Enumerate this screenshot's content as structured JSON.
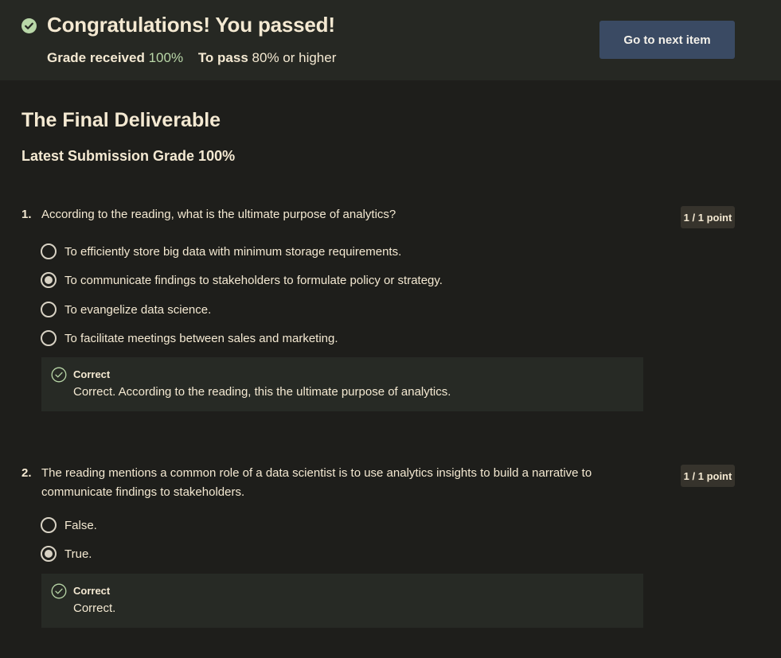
{
  "banner": {
    "title": "Congratulations! You passed!",
    "grade_label": "Grade received",
    "grade_value": "100%",
    "pass_label": "To pass",
    "pass_value": "80% or higher",
    "next_button": "Go to next item"
  },
  "page": {
    "title": "The Final Deliverable",
    "latest_grade": "Latest Submission Grade 100%"
  },
  "questions": [
    {
      "number": "1.",
      "text": "According to the reading, what is the ultimate purpose of analytics?",
      "points": "1 / 1 point",
      "options": [
        {
          "label": "To efficiently store big data with minimum storage requirements.",
          "selected": false
        },
        {
          "label": "To communicate findings to stakeholders to formulate policy or strategy.",
          "selected": true
        },
        {
          "label": "To evangelize data science.",
          "selected": false
        },
        {
          "label": "To facilitate meetings between sales and marketing.",
          "selected": false
        }
      ],
      "feedback_title": "Correct",
      "feedback_text": "Correct. According to the reading, this the ultimate purpose of analytics."
    },
    {
      "number": "2.",
      "text": "The reading mentions a common role of a data scientist is to use analytics insights to build a narrative to communicate findings to stakeholders.",
      "points": "1 / 1 point",
      "options": [
        {
          "label": "False.",
          "selected": false
        },
        {
          "label": "True.",
          "selected": true
        }
      ],
      "feedback_title": "Correct",
      "feedback_text": "Correct."
    }
  ],
  "colors": {
    "background": "#1e1e1b",
    "banner": "#262823",
    "button": "#3a4a63",
    "success": "#b9d7a8"
  }
}
